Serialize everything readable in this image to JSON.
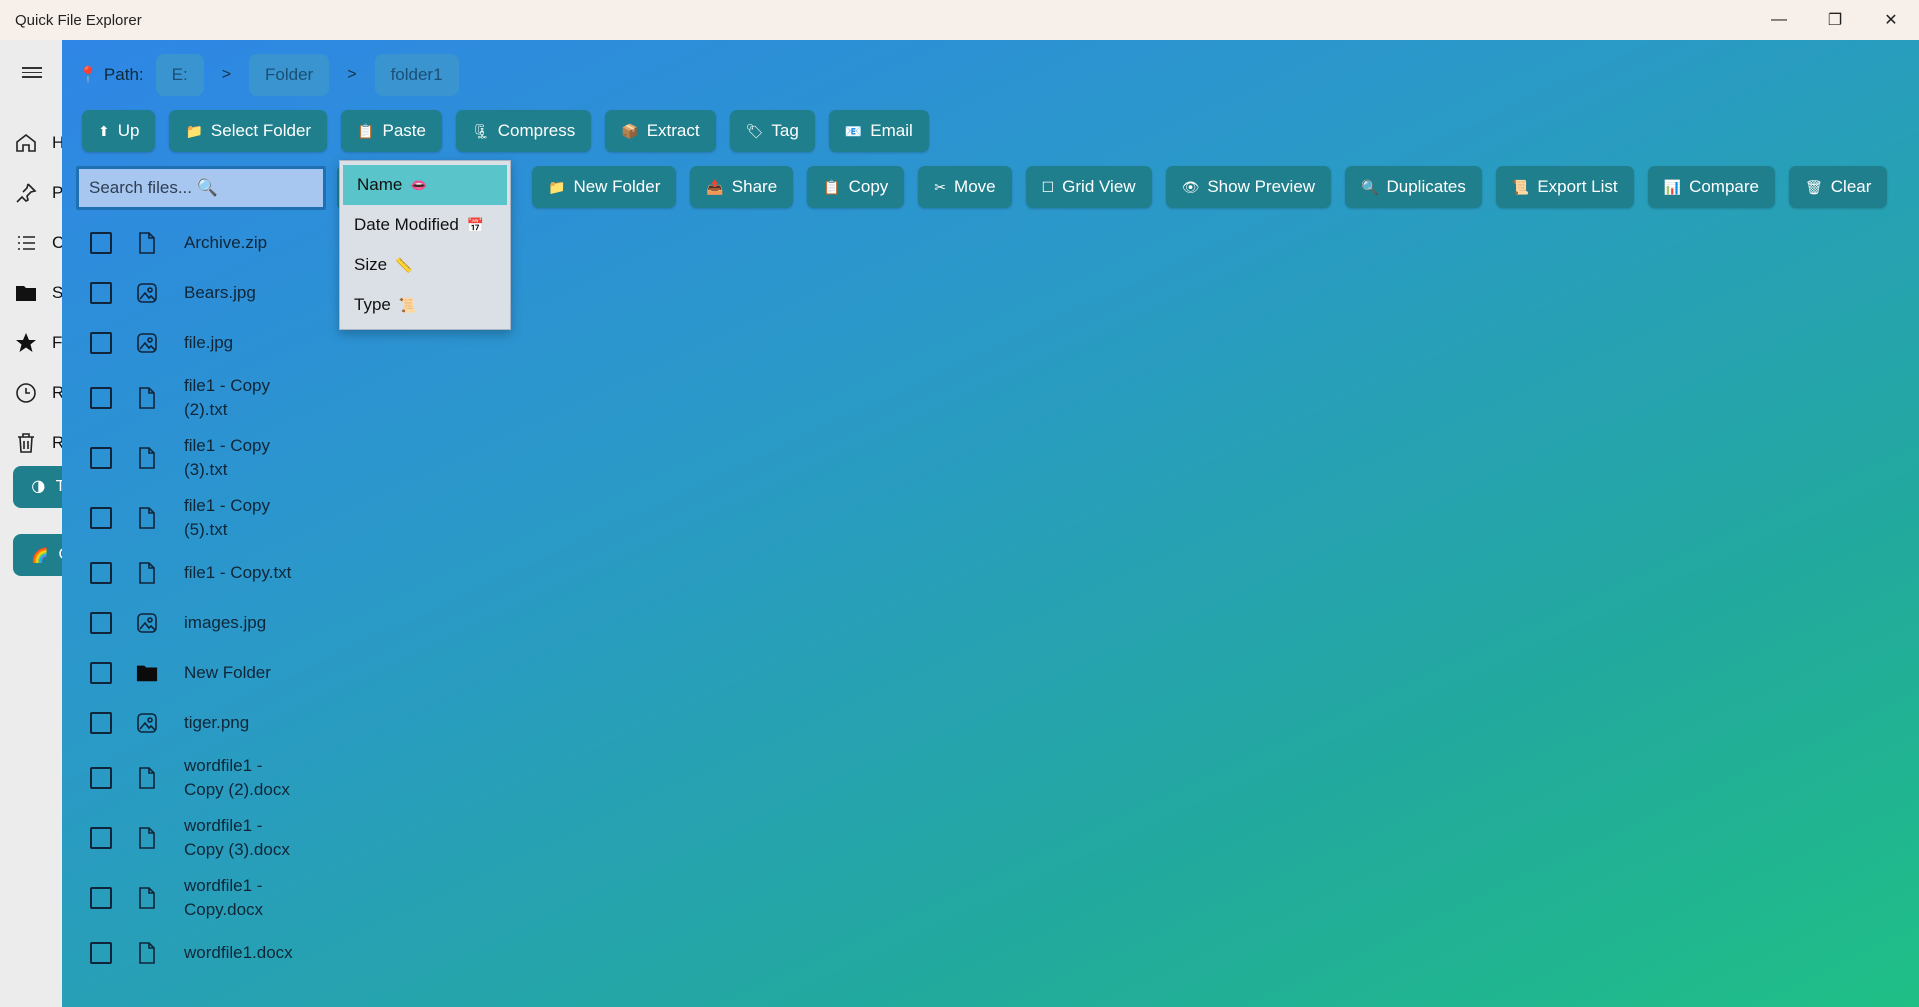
{
  "window": {
    "title": "Quick File Explorer",
    "controls": {
      "minimize": "—",
      "maximize": "❐",
      "close": "✕"
    }
  },
  "sidenav": {
    "items": [
      {
        "label": "H",
        "icon": "home-icon"
      },
      {
        "label": "P",
        "icon": "pin-icon"
      },
      {
        "label": "C",
        "icon": "list-icon"
      },
      {
        "label": "S",
        "icon": "folder-icon"
      },
      {
        "label": "F",
        "icon": "star-icon"
      },
      {
        "label": "R",
        "icon": "clock-icon"
      },
      {
        "label": "R",
        "icon": "trash-icon"
      }
    ],
    "pills": [
      {
        "label": "T",
        "icon": "🌗"
      },
      {
        "label": "C",
        "icon": "🌈"
      }
    ]
  },
  "path": {
    "label": "Path:",
    "icon": "📍",
    "separator": ">",
    "crumbs": [
      "E:",
      "Folder",
      "folder1"
    ]
  },
  "toolbar1": [
    {
      "label": "Up",
      "icon": "⬆"
    },
    {
      "label": "Select Folder",
      "icon": "📁"
    },
    {
      "label": "Paste",
      "icon": "📋"
    },
    {
      "label": "Compress",
      "icon": "🗜"
    },
    {
      "label": "Extract",
      "icon": "📦"
    },
    {
      "label": "Tag",
      "icon": "🏷"
    },
    {
      "label": "Email",
      "icon": "📧"
    }
  ],
  "toolbar2": [
    {
      "label": "New Folder",
      "icon": "📁"
    },
    {
      "label": "Share",
      "icon": "📤"
    },
    {
      "label": "Copy",
      "icon": "📋"
    },
    {
      "label": "Move",
      "icon": "✂"
    },
    {
      "label": "Grid View",
      "icon": "☐"
    },
    {
      "label": "Show Preview",
      "icon": "👁"
    },
    {
      "label": "Duplicates",
      "icon": "🔍"
    },
    {
      "label": "Export List",
      "icon": "📜"
    },
    {
      "label": "Compare",
      "icon": "📊"
    },
    {
      "label": "Clear",
      "icon": "🗑"
    }
  ],
  "search": {
    "placeholder": "Search files... 🔍"
  },
  "sort_dropdown": {
    "selected": "Name",
    "options": [
      {
        "label": "Name",
        "icon": "👄"
      },
      {
        "label": "Date Modified",
        "icon": "📅"
      },
      {
        "label": "Size",
        "icon": "📏"
      },
      {
        "label": "Type",
        "icon": "📜"
      }
    ]
  },
  "files": [
    {
      "line1": "Archive.zip",
      "line2": "",
      "type": "file"
    },
    {
      "line1": "Bears.jpg",
      "line2": "",
      "type": "image"
    },
    {
      "line1": "file.jpg",
      "line2": "",
      "type": "image"
    },
    {
      "line1": "file1 - Copy",
      "line2": "(2).txt",
      "type": "file"
    },
    {
      "line1": "file1 - Copy",
      "line2": "(3).txt",
      "type": "file"
    },
    {
      "line1": "file1 - Copy",
      "line2": "(5).txt",
      "type": "file"
    },
    {
      "line1": "file1 - Copy.txt",
      "line2": "",
      "type": "file"
    },
    {
      "line1": "images.jpg",
      "line2": "",
      "type": "image"
    },
    {
      "line1": "New Folder",
      "line2": "",
      "type": "folder"
    },
    {
      "line1": "tiger.png",
      "line2": "",
      "type": "image"
    },
    {
      "line1": "wordfile1 -",
      "line2": "Copy (2).docx",
      "type": "file"
    },
    {
      "line1": "wordfile1 -",
      "line2": "Copy (3).docx",
      "type": "file"
    },
    {
      "line1": "wordfile1 -",
      "line2": "Copy.docx",
      "type": "file"
    },
    {
      "line1": "wordfile1.docx",
      "line2": "",
      "type": "file"
    }
  ]
}
